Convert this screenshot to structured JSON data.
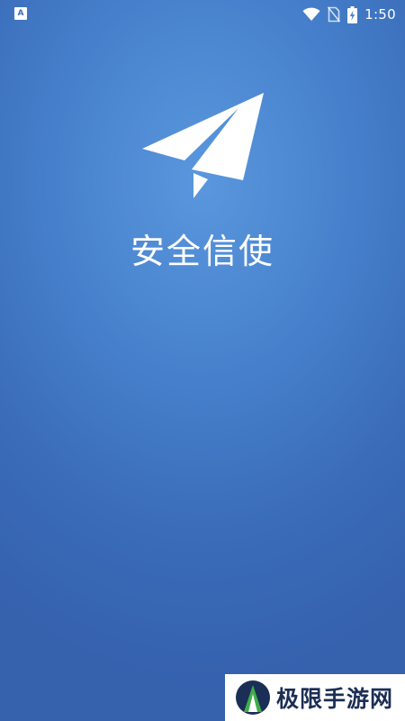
{
  "status_bar": {
    "left_icon": "a-notification-icon",
    "left_icon_text": "A",
    "icons": [
      "wifi-icon",
      "no-sim-icon",
      "battery-charging-icon"
    ],
    "time": "1:50"
  },
  "splash": {
    "logo_icon": "paper-plane-icon",
    "app_name": "安全信使"
  },
  "watermark": {
    "logo_icon": "jixian-logo-icon",
    "text": "极限手游网"
  },
  "colors": {
    "background_top": "#5a97dd",
    "background_bottom": "#3561ad",
    "foreground": "#ffffff",
    "watermark_text": "#1b2e55",
    "watermark_logo_dark": "#1b2e55",
    "watermark_logo_green": "#3fae49"
  }
}
